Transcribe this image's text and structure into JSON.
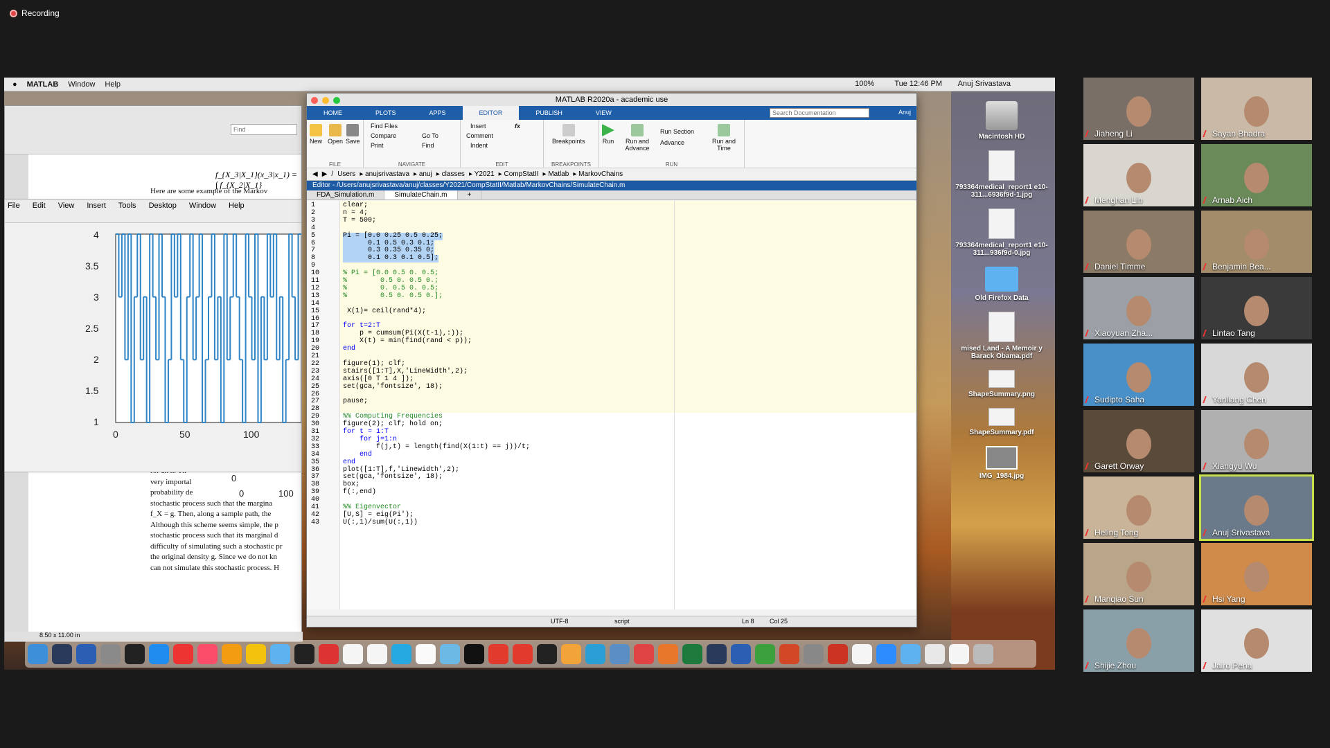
{
  "recording": {
    "label": "Recording"
  },
  "mac_menubar": {
    "app": "MATLAB",
    "items": [
      "Window",
      "Help"
    ],
    "clock": "Tue 12:46 PM",
    "user": "Anuj Srivastava",
    "battery": "100%"
  },
  "pdf_viewer": {
    "find_placeholder": "Find",
    "formula": "f_{X_3|X_1}(x_3|x_1) = ∫ f_{X_2|X_1}",
    "intro": "Here are some example of the Markov",
    "body_lines": [
      "for an n. Th",
      "very importal",
      "probability de",
      "stochastic process such that the margina",
      "f_X = g. Then, along a sample path, the",
      "Although this scheme seems simple, the p",
      "stochastic process such that its marginal d",
      "difficulty of simulating such a stochastic pr",
      "the original density g. Since we do not kn",
      "can not simulate this stochastic process. H"
    ],
    "page_size": "8.50 x 11.00 in",
    "axis_ticks": [
      "0",
      "0",
      "100"
    ]
  },
  "figure_window": {
    "menu": [
      "File",
      "Edit",
      "View",
      "Insert",
      "Tools",
      "Desktop",
      "Window",
      "Help"
    ],
    "y_ticks": [
      "4",
      "3.5",
      "3",
      "2.5",
      "2",
      "1.5",
      "1"
    ],
    "x_ticks": [
      "0",
      "50",
      "100"
    ]
  },
  "matlab": {
    "title": "MATLAB R2020a - academic use",
    "tabs": [
      "HOME",
      "PLOTS",
      "APPS",
      "EDITOR",
      "PUBLISH",
      "VIEW"
    ],
    "active_tab": "EDITOR",
    "search_placeholder": "Search Documentation",
    "user": "Anuj",
    "ribbon": {
      "file": {
        "label": "FILE",
        "new": "New",
        "open": "Open",
        "save": "Save"
      },
      "navigate": {
        "label": "NAVIGATE",
        "find_files": "Find Files",
        "compare": "Compare",
        "print": "Print",
        "goto": "Go To",
        "find": "Find"
      },
      "edit": {
        "label": "EDIT",
        "insert": "Insert",
        "comment": "Comment",
        "indent": "Indent"
      },
      "breakpoints": {
        "label": "BREAKPOINTS",
        "btn": "Breakpoints"
      },
      "run": {
        "label": "RUN",
        "run": "Run",
        "run_advance": "Run and Advance",
        "run_section": "Run Section",
        "advance": "Advance",
        "run_time": "Run and Time"
      }
    },
    "path": [
      "/",
      "Users",
      "anujsrivastava",
      "anuj",
      "classes",
      "Y2021",
      "CompStatII",
      "Matlab",
      "MarkovChains"
    ],
    "editor_title": "Editor - /Users/anujsrivastava/anuj/classes/Y2021/CompStatII/Matlab/MarkovChains/SimulateChain.m",
    "file_tabs": [
      "FDA_Simulation.m",
      "SimulateChain.m"
    ],
    "active_file": "SimulateChain.m",
    "code": [
      {
        "n": "1",
        "t": "clear;"
      },
      {
        "n": "2",
        "t": "n = 4;"
      },
      {
        "n": "3",
        "t": "T = 500;"
      },
      {
        "n": "4",
        "t": ""
      },
      {
        "n": "5",
        "t": "Pi = [0.0 0.25 0.5 0.25;"
      },
      {
        "n": "6",
        "t": "      0.1 0.5 0.3 0.1;"
      },
      {
        "n": "7",
        "t": "      0.3 0.35 0.35 0;"
      },
      {
        "n": "8",
        "t": "      0.1 0.3 0.1 0.5];"
      },
      {
        "n": "9",
        "t": ""
      },
      {
        "n": "10",
        "t": "% Pi = [0.0 0.5 0. 0.5;"
      },
      {
        "n": "11",
        "t": "%        0.5 0. 0.5 0.;"
      },
      {
        "n": "12",
        "t": "%        0. 0.5 0. 0.5;"
      },
      {
        "n": "13",
        "t": "%        0.5 0. 0.5 0.];"
      },
      {
        "n": "14",
        "t": ""
      },
      {
        "n": "15",
        "t": " X(1)= ceil(rand*4);"
      },
      {
        "n": "16",
        "t": ""
      },
      {
        "n": "17",
        "t": "for t=2:T"
      },
      {
        "n": "18",
        "t": "    p = cumsum(Pi(X(t-1),:));"
      },
      {
        "n": "19",
        "t": "    X(t) = min(find(rand < p));"
      },
      {
        "n": "20",
        "t": "end"
      },
      {
        "n": "21",
        "t": ""
      },
      {
        "n": "22",
        "t": "figure(1); clf;"
      },
      {
        "n": "23",
        "t": "stairs([1:T],X,'LineWidth',2);"
      },
      {
        "n": "24",
        "t": "axis([0 T 1 4 ]);"
      },
      {
        "n": "25",
        "t": "set(gca,'fontsize', 18);"
      },
      {
        "n": "26",
        "t": ""
      },
      {
        "n": "27",
        "t": "pause;"
      },
      {
        "n": "28",
        "t": ""
      },
      {
        "n": "29",
        "t": "%% Computing Frequencies"
      },
      {
        "n": "30",
        "t": "figure(2); clf; hold on;"
      },
      {
        "n": "31",
        "t": "for t = 1:T"
      },
      {
        "n": "32",
        "t": "    for j=1:n"
      },
      {
        "n": "33",
        "t": "        f(j,t) = length(find(X(1:t) == j))/t;"
      },
      {
        "n": "34",
        "t": "    end"
      },
      {
        "n": "35",
        "t": "end"
      },
      {
        "n": "36",
        "t": "plot([1:T],f,'Linewidth',2);"
      },
      {
        "n": "37",
        "t": "set(gca,'fontsize', 18);"
      },
      {
        "n": "38",
        "t": "box;"
      },
      {
        "n": "39",
        "t": "f(:,end)"
      },
      {
        "n": "40",
        "t": ""
      },
      {
        "n": "41",
        "t": "%% Eigenvector"
      },
      {
        "n": "42",
        "t": "[U,S] = eig(Pi');"
      },
      {
        "n": "43",
        "t": "U(:,1)/sum(U(:,1))"
      }
    ],
    "status": {
      "encoding": "UTF-8",
      "type": "script",
      "ln": "Ln  8",
      "col": "Col  25"
    }
  },
  "desktop_icons": [
    "Macintosh HD",
    "793364medical_report1 e10-311...6936f9d-1.jpg",
    "793364medical_report1 e10-311...936f9d-0.jpg",
    "Old Firefox Data",
    "mised Land - A Memoir y Barack Obama.pdf",
    "ShapeSummary.png",
    "ShapeSummary.pdf",
    "IMG_1984.jpg"
  ],
  "participants": [
    "Jiaheng Li",
    "Sayan Bhadra",
    "Menghan Lin",
    "Arnab Aich",
    "Daniel Timme",
    "Benjamin Bea...",
    "Xiaoyuan Zha...",
    "Lintao Tang",
    "Sudipto Saha",
    "Yanliang Chen",
    "Garett Orway",
    "Xiangyu Wu",
    "Heling Tong",
    "Anuj Srivastava",
    "Manqiao Sun",
    "Hsi Yang",
    "Shijie Zhou",
    "Jairo Pena"
  ],
  "active_speaker": "Anuj Srivastava",
  "colors": {
    "matlab_blue": "#1e5ea8",
    "cell_bg": "#fdfbe2",
    "plot_line": "#2f84c6",
    "speaker_border": "#c8e04a"
  }
}
